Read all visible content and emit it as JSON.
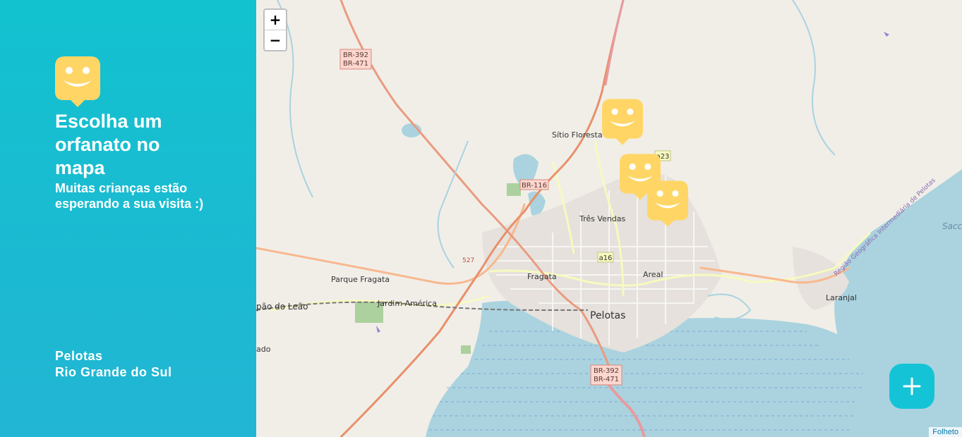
{
  "sidebar": {
    "title": "Escolha um orfanato no mapa",
    "subtitle": "Muitas crianças estão esperando a sua visita :)",
    "location": {
      "city": "Pelotas",
      "state": "Rio Grande do Sul"
    }
  },
  "map": {
    "zoom_in": "+",
    "zoom_out": "−",
    "attribution": "Folheto",
    "labels": {
      "br392_top_a": "BR-392",
      "br392_top_b": "BR-471",
      "br116": "BR-116",
      "br392_bot_a": "BR-392",
      "br392_bot_b": "BR-471",
      "a23": "a23",
      "a16": "a16",
      "r527": "527",
      "sitio_floresta": "Sítio Floresta",
      "tres_vendas": "Três Vendas",
      "fragata": "Fragata",
      "areal": "Areal",
      "pelotas": "Pelotas",
      "parque_fragata": "Parque Fragata",
      "jardim_america": "Jardim América",
      "capao_do_leao": "pão do Leão",
      "ado": "ado",
      "laranjal": "Laranjal",
      "sacc": "Sacc",
      "regiao": "Região Geográfica Intermediária de Pelotas"
    }
  },
  "colors": {
    "accent": "#15c3d6",
    "marker": "#ffd666",
    "water": "#aad3df"
  },
  "icons": {
    "logo": "smile-marker-icon",
    "fab": "plus-icon",
    "plane": "airplane-icon"
  }
}
